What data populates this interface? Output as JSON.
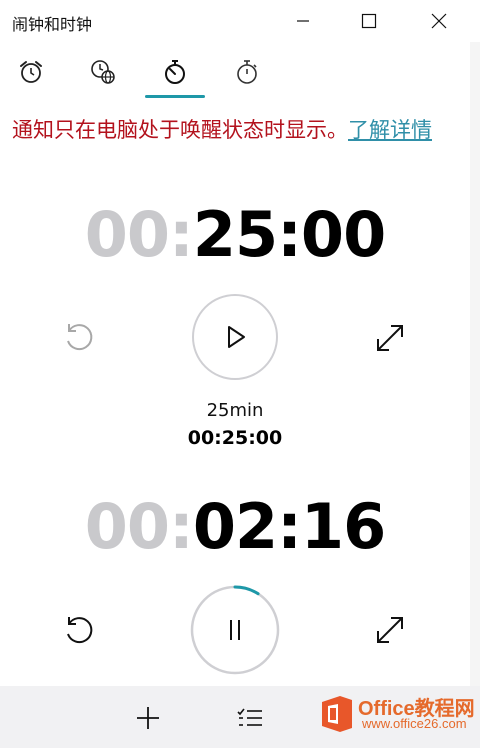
{
  "window": {
    "title": "闹钟和时钟"
  },
  "tabs": [
    {
      "name": "alarm",
      "icon": "alarm-clock-icon"
    },
    {
      "name": "world-clock",
      "icon": "world-clock-icon"
    },
    {
      "name": "timer",
      "icon": "timer-icon",
      "selected": true
    },
    {
      "name": "stopwatch",
      "icon": "stopwatch-icon"
    }
  ],
  "notice": {
    "text": "通知只在电脑处于唤醒状态时显示。",
    "link": "了解详情"
  },
  "timers": [
    {
      "hours": "00:",
      "minsecs": "25:00",
      "name": "25min",
      "duration": "00:25:00",
      "state": "stopped",
      "progress": 0.0
    },
    {
      "hours": "00:",
      "minsecs": "02:16",
      "state": "running",
      "progress": 0.09
    }
  ],
  "bottom_bar": [
    {
      "icon": "add-icon"
    },
    {
      "icon": "select-list-icon"
    }
  ],
  "watermark": {
    "brand": "Office教程网",
    "url": "www.office26.com"
  },
  "colors": {
    "accent": "#1e98a8",
    "notice": "#b3121d",
    "link": "#2f8fa8"
  }
}
